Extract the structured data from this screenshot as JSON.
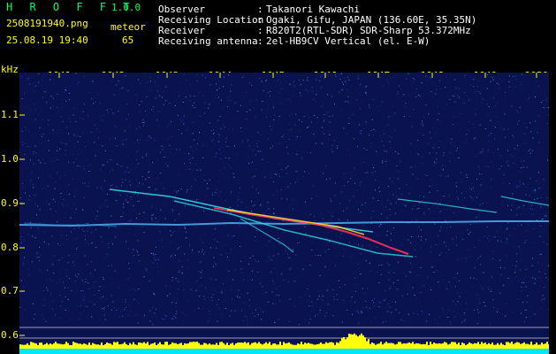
{
  "app": {
    "title": "H R O F F T",
    "version": "1.0.0",
    "file_name": "2508191940.png",
    "date_time": "25.08.19 19:40",
    "meteor_label": "meteor",
    "meteor_count": "65"
  },
  "info": [
    {
      "label": "Observer",
      "value": "Takanori Kawachi"
    },
    {
      "label": "Receiving Location",
      "value": "Ogaki, Gifu, JAPAN (136.60E, 35.35N)"
    },
    {
      "label": "Receiver",
      "value": "R820T2(RTL-SDR) SDR-Sharp 53.372MHz"
    },
    {
      "label": "Receiving antenna",
      "value": "2el-HB9CV Vertical (el. E-W)"
    }
  ],
  "info_separator": ":",
  "freq_unit": "kHz",
  "time_ticks": [
    "1941",
    "1942",
    "1943",
    "1944",
    "1945",
    "1946",
    "1947",
    "1948",
    "1949",
    "1950"
  ],
  "freq_ticks": [
    "1.1",
    "1.0",
    "0.9",
    "0.8",
    "0.7",
    "0.6"
  ],
  "colors": {
    "background": "#000000",
    "spectrogram_bg": "#0a1250",
    "text_yellow": "#ffff00",
    "text_white": "#ffffff",
    "title_green": "#00ff66",
    "carrier": "#49a7e6",
    "meteor_hot": "#ff3355",
    "meteor_warm": "#ffdd33",
    "meteor_cool": "#33e6e6",
    "level_bar": "#ffff00",
    "level_base": "#00e6ff"
  }
}
